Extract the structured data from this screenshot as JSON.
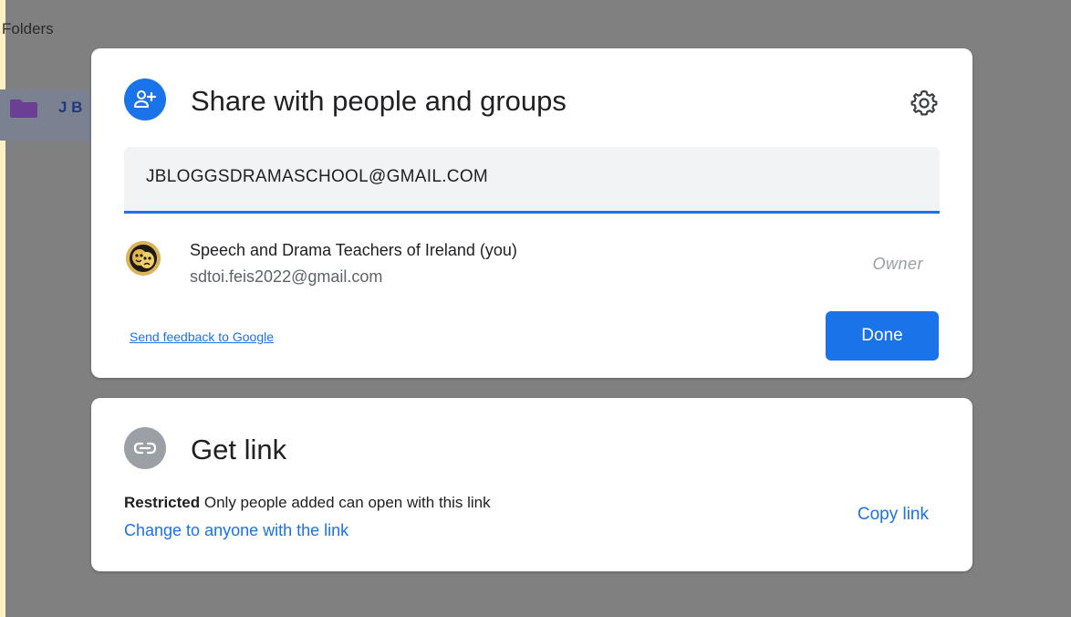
{
  "background": {
    "folders_heading": "Folders",
    "folder_name": "J B"
  },
  "share_dialog": {
    "title": "Share with people and groups",
    "input_value": "JBLOGGSDRAMASCHOOL@GMAIL.COM",
    "person": {
      "name": "Speech and Drama Teachers of Ireland (you)",
      "email": "sdtoi.feis2022@gmail.com",
      "role": "Owner"
    },
    "feedback_link": "Send feedback to Google",
    "done_label": "Done"
  },
  "link_dialog": {
    "title": "Get link",
    "restricted_label": "Restricted",
    "restricted_desc": " Only people added can open with this link",
    "change_link": "Change to anyone with the link",
    "copy_link": "Copy link"
  },
  "icons": {
    "share": "person-add-icon",
    "settings": "gear-icon",
    "link": "link-icon",
    "folder": "folder-icon",
    "avatar": "drama-masks-avatar"
  },
  "colors": {
    "accent": "#1a73e8",
    "backdrop": "#808080",
    "card": "#ffffff",
    "link_circle": "#9aa0a6",
    "folder": "#6b3f93"
  }
}
